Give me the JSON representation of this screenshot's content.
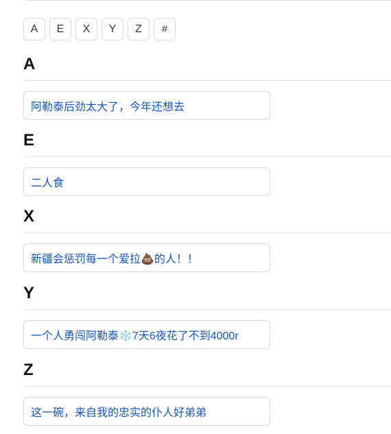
{
  "index": [
    "A",
    "E",
    "X",
    "Y",
    "Z",
    "#"
  ],
  "sections": [
    {
      "letter": "A",
      "entry": "阿勒泰后劲太大了，今年还想去"
    },
    {
      "letter": "E",
      "entry": "二人食"
    },
    {
      "letter": "X",
      "entry": "新疆会惩罚每一个爱拉💩的人！！"
    },
    {
      "letter": "Y",
      "entry": "一个人勇闯阿勒泰❄️7天6夜花了不到4000r"
    },
    {
      "letter": "Z",
      "entry": "这一碗，来自我的忠实的仆人好弟弟"
    }
  ]
}
